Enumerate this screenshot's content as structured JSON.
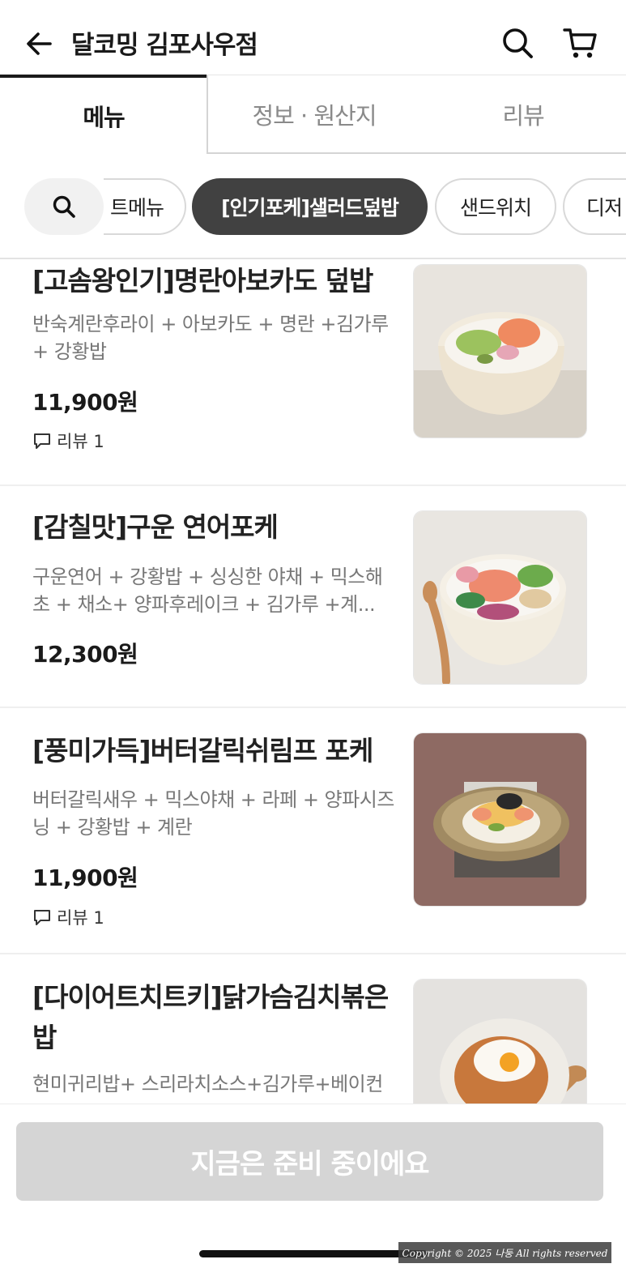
{
  "header": {
    "store_name": "달코밍 김포사우점",
    "icons": [
      "arrow-left-icon",
      "search-icon",
      "cart-icon"
    ]
  },
  "tabs": [
    {
      "label": "메뉴",
      "active": true
    },
    {
      "label": "정보 · 원산지",
      "active": false
    },
    {
      "label": "리뷰",
      "active": false
    }
  ],
  "categories": [
    {
      "label": "트메뉴",
      "active": false
    },
    {
      "label": "[인기포케]샐러드덮밥",
      "active": true
    },
    {
      "label": "샌드위치",
      "active": false
    },
    {
      "label": "디저",
      "active": false
    }
  ],
  "menu_items": [
    {
      "name": "[고솜왕인기]명란아보카도 덮밥",
      "description": "반숙계란후라이 + 아보카도 + 명란 +김가루 + 강황밥",
      "price": "11,900원",
      "review": "리뷰 1"
    },
    {
      "name": "[감칠맛]구운 연어포케",
      "description": "구운연어 + 강황밥 + 싱싱한 야채 + 믹스해초 + 채소+  양파후레이크 + 김가루 +계...",
      "price": "12,300원",
      "review": ""
    },
    {
      "name": "[풍미가득]버터갈릭쉬림프 포케",
      "description": "버터갈릭새우 + 믹스야채 + 라페 + 양파시즈닝 + 강황밥 + 계란",
      "price": "11,900원",
      "review": "리뷰 1"
    },
    {
      "name": "[다이어트치트키]닭가슴김치볶은밥",
      "description": "현미귀리밥+ 스리라치소스+김가루+베이컨",
      "price": "",
      "review": ""
    }
  ],
  "bottom": {
    "order_button": "지금은 준비 중이에요",
    "copyright": "Copyright © 2025 나둥 All rights reserved"
  },
  "colors": {
    "active_chip": "#414141",
    "disabled_button": "#d5d5d5",
    "description_text": "#777777"
  }
}
